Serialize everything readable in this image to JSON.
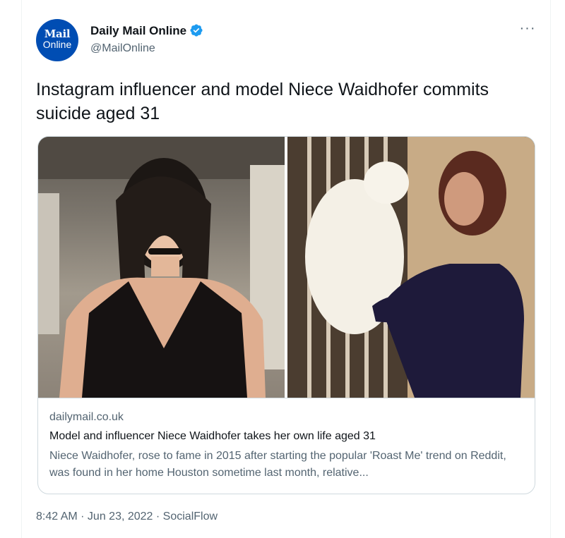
{
  "author": {
    "avatar_line1": "Mail",
    "avatar_line2": "Online",
    "name": "Daily Mail Online",
    "handle": "@MailOnline"
  },
  "more_label": "···",
  "tweet": {
    "text": "Instagram influencer and model Niece Waidhofer commits suicide aged 31"
  },
  "card": {
    "domain": "dailymail.co.uk",
    "title": "Model and influencer Niece Waidhofer takes her own life aged 31",
    "description": "Niece Waidhofer, rose to fame in 2015 after starting the popular 'Roast Me' trend on Reddit, was found in her home Houston sometime last month, relative..."
  },
  "meta": {
    "time": "8:42 AM",
    "sep1": " · ",
    "date": "Jun 23, 2022",
    "sep2": " · ",
    "source": "SocialFlow"
  },
  "colors": {
    "verified": "#1d9bf0",
    "avatar_bg": "#004db3",
    "secondary_text": "#536471",
    "border": "#cfd9de"
  },
  "icons": {
    "verified": "verified-badge-icon",
    "more": "more-options-icon"
  }
}
